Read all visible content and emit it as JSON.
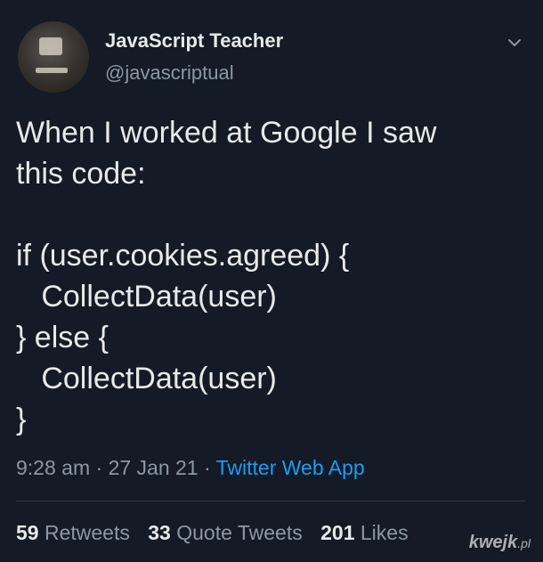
{
  "author": {
    "display_name": "JavaScript Teacher",
    "handle": "@javascriptual"
  },
  "tweet": {
    "lines": [
      "When I worked at Google I saw",
      "this code:",
      "",
      "if (user.cookies.agreed) {",
      "   CollectData(user)",
      "} else {",
      "   CollectData(user)",
      "}"
    ],
    "time": "9:28 am",
    "date": "27 Jan 21",
    "source": "Twitter Web App",
    "separator": "·"
  },
  "stats": {
    "retweets_count": "59",
    "retweets_label": "Retweets",
    "quotes_count": "33",
    "quotes_label": "Quote Tweets",
    "likes_count": "201",
    "likes_label": "Likes"
  },
  "watermark": {
    "brand": "kwejk",
    "tld": ".pl"
  },
  "icons": {
    "menu": "chevron-down-icon"
  },
  "colors": {
    "background": "#141a26",
    "text": "#e7e9ea",
    "muted": "#8b98a5",
    "link": "#1d9bf0"
  }
}
